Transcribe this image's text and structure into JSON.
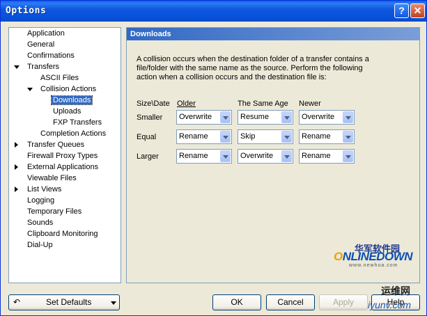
{
  "window": {
    "title": "Options",
    "help_glyph": "?",
    "close_glyph": "✕"
  },
  "tree": {
    "items": [
      {
        "label": "Application"
      },
      {
        "label": "General"
      },
      {
        "label": "Confirmations"
      },
      {
        "label": "Transfers",
        "expanded": true
      },
      {
        "label": "ASCII Files"
      },
      {
        "label": "Collision Actions",
        "expanded": true
      },
      {
        "label": "Downloads",
        "selected": true
      },
      {
        "label": "Uploads"
      },
      {
        "label": "FXP Transfers"
      },
      {
        "label": "Completion Actions"
      },
      {
        "label": "Transfer Queues",
        "collapsed": true
      },
      {
        "label": "Firewall Proxy Types"
      },
      {
        "label": "External Applications",
        "collapsed": true
      },
      {
        "label": "Viewable Files"
      },
      {
        "label": "List Views",
        "collapsed": true
      },
      {
        "label": "Logging"
      },
      {
        "label": "Temporary Files"
      },
      {
        "label": "Sounds"
      },
      {
        "label": "Clipboard Monitoring"
      },
      {
        "label": "Dial-Up"
      }
    ]
  },
  "panel": {
    "title": "Downloads",
    "description": "A collision occurs when the destination folder of a transfer contains a file/folder with the same name as the source. Perform the following action when a collision occurs and the destination file is:",
    "columns": {
      "size_date": "Size\\Date",
      "older": "Older",
      "same_age": "The Same Age",
      "newer": "Newer"
    },
    "rows": [
      {
        "label": "Smaller",
        "older": "Overwrite",
        "same_age": "Resume",
        "newer": "Overwrite"
      },
      {
        "label": "Equal",
        "older": "Rename",
        "same_age": "Skip",
        "newer": "Rename"
      },
      {
        "label": "Larger",
        "older": "Rename",
        "same_age": "Overwrite",
        "newer": "Rename"
      }
    ]
  },
  "buttons": {
    "set_defaults": "Set Defaults",
    "ok": "OK",
    "cancel": "Cancel",
    "apply": "Apply",
    "help": "Help"
  },
  "watermark": {
    "brand_cn": "华军软件园",
    "brand_en_o": "O",
    "brand_en_rest": "NLINEDOWN",
    "url": "www.newhua.com",
    "site_cn": "运维网",
    "site_url": "iyunv.com"
  }
}
